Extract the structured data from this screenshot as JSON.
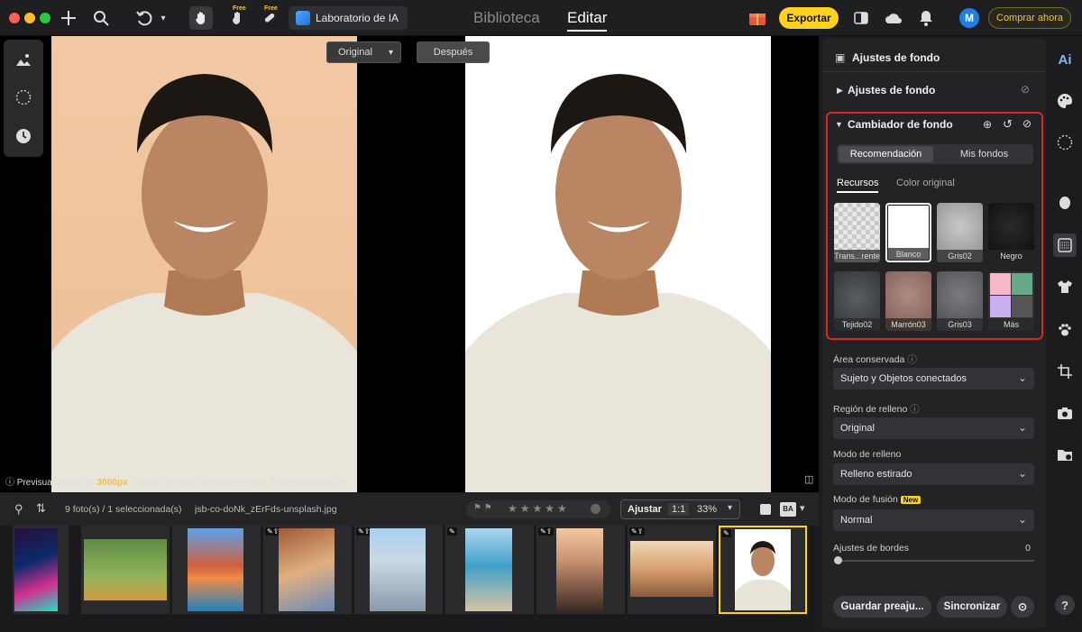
{
  "topbar": {
    "lab_button": "Laboratorio de IA",
    "free_badge": "Free",
    "tabs": [
      "Biblioteca",
      "Editar"
    ],
    "export_button": "Exportar",
    "avatar_initial": "M",
    "buy_button": "Comprar ahora"
  },
  "canvas": {
    "compare_dropdown": "Original",
    "after_button": "Después",
    "preview_note_prefix": "Previsualización de",
    "preview_note_size": "3000px",
    "preview_note_suffix": "- Marca de agua solo para versión de previsualización"
  },
  "filmstrip": {
    "status": "9 foto(s) / 1 seleccionada(s)",
    "filename": "jsb-co-doNk_zErFds-unsplash.jpg",
    "fit_button": "Ajustar",
    "ratio_button": "1:1",
    "zoom": "33%",
    "ba_label": "BA"
  },
  "panel": {
    "header": "Ajustes de fondo",
    "section_collapsed": "Ajustes de fondo",
    "changer_title": "Cambiador de fondo",
    "seg_tabs": [
      "Recomendación",
      "Mis fondos"
    ],
    "sub_tabs": [
      "Recursos",
      "Color original"
    ],
    "swatches": [
      "Trans...rente",
      "Blanco",
      "Gris02",
      "Negro",
      "Tejido02",
      "Marrón03",
      "Gris03",
      "Más"
    ],
    "preserved_area_label": "Área conservada",
    "preserved_area_value": "Sujeto y Objetos conectados",
    "fill_region_label": "Región de relleno",
    "fill_region_value": "Original",
    "fill_mode_label": "Modo de relleno",
    "fill_mode_value": "Relleno estirado",
    "blend_mode_label": "Modo de fusión",
    "new_badge": "New",
    "blend_mode_value": "Normal",
    "edge_label": "Ajustes de bordes",
    "edge_value": "0",
    "save_preset_button": "Guardar preaju...",
    "sync_button": "Sincronizar"
  },
  "right_rail": {
    "ai_label": "Ai",
    "help_label": "?"
  },
  "colors": {
    "accent": "#ffd21f",
    "highlight_border": "#e0242a"
  }
}
